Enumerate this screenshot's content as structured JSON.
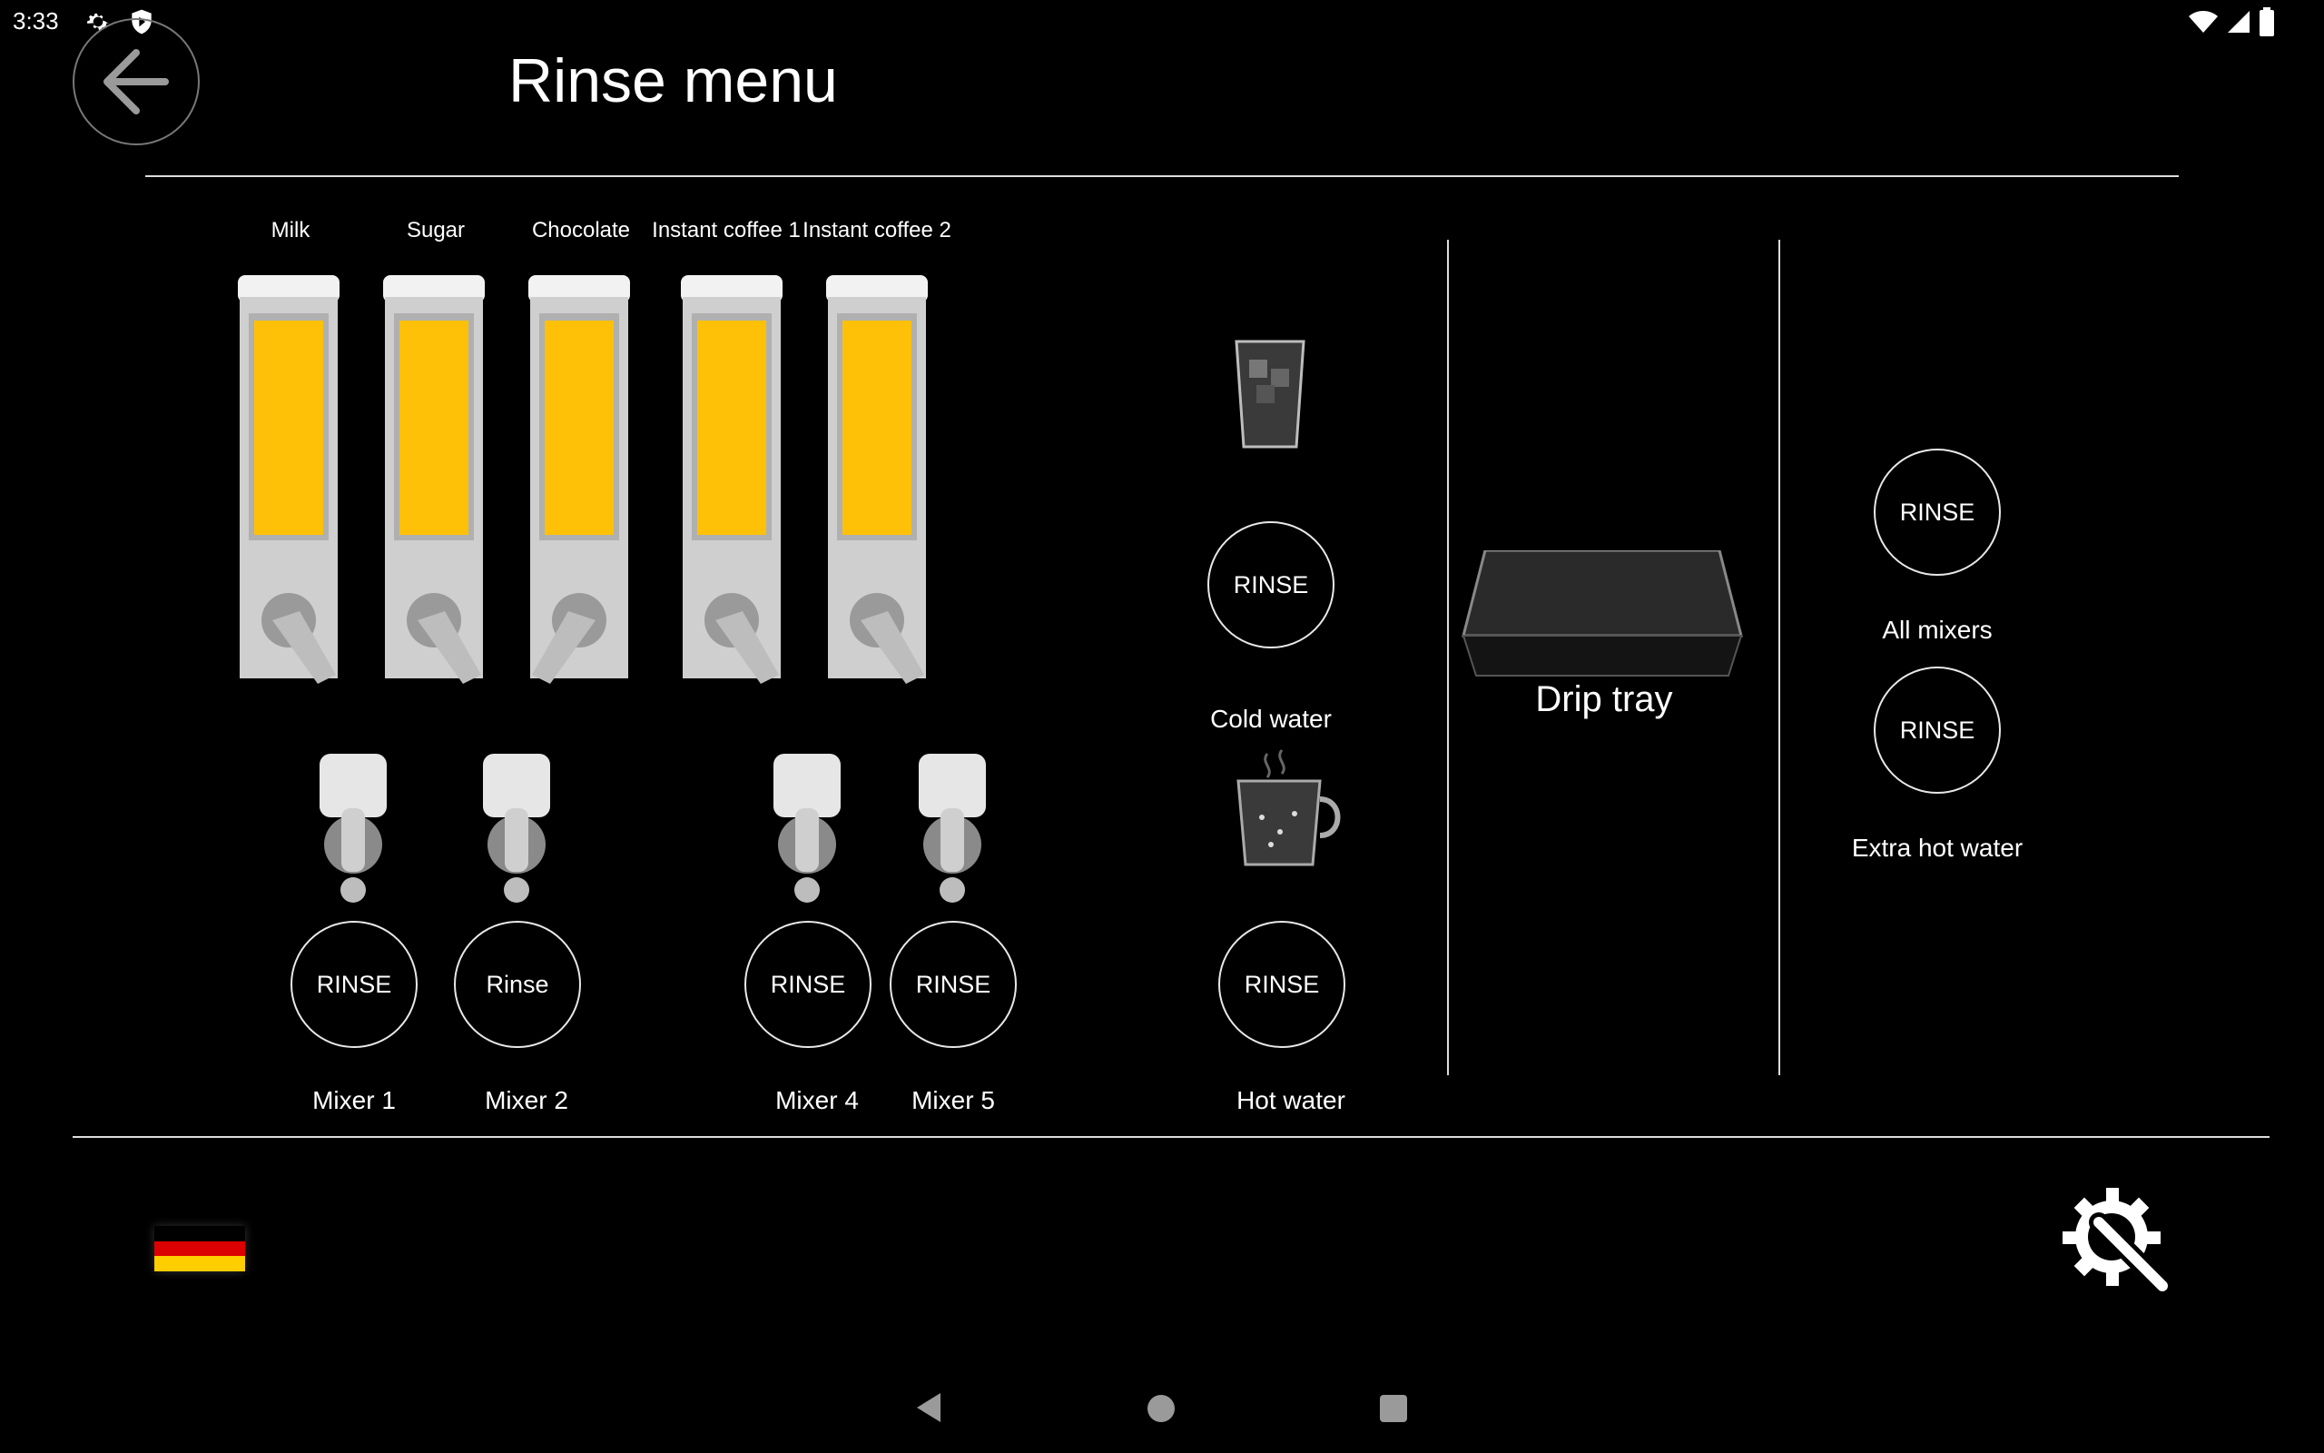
{
  "status_bar": {
    "time": "3:33"
  },
  "header": {
    "title": "Rinse menu"
  },
  "canisters": [
    {
      "label": "Milk",
      "color": "#FFC107"
    },
    {
      "label": "Sugar",
      "color": "#FFC107"
    },
    {
      "label": "Chocolate",
      "color": "#FFC107"
    },
    {
      "label": "Instant coffee 1",
      "color": "#FFC107"
    },
    {
      "label": "Instant coffee 2",
      "color": "#FFC107"
    }
  ],
  "mixers": [
    {
      "button": "RINSE",
      "label": "Mixer 1"
    },
    {
      "button": "Rinse",
      "label": "Mixer 2"
    },
    {
      "button": "RINSE",
      "label": "Mixer 4"
    },
    {
      "button": "RINSE",
      "label": "Mixer 5"
    }
  ],
  "cold_water": {
    "button": "RINSE",
    "label": "Cold water"
  },
  "hot_water": {
    "button": "RINSE",
    "label": "Hot water"
  },
  "drip_tray": {
    "label": "Drip tray"
  },
  "all_mixers": {
    "button": "RINSE",
    "label": "All mixers"
  },
  "extra_hot_water": {
    "button": "RINSE",
    "label": "Extra hot water"
  },
  "footer": {
    "language_flag": "Germany",
    "settings_icon": "gear-wrench-icon"
  },
  "colors": {
    "accent": "#FFC107",
    "background": "#000000",
    "line": "#DDDDDD"
  }
}
